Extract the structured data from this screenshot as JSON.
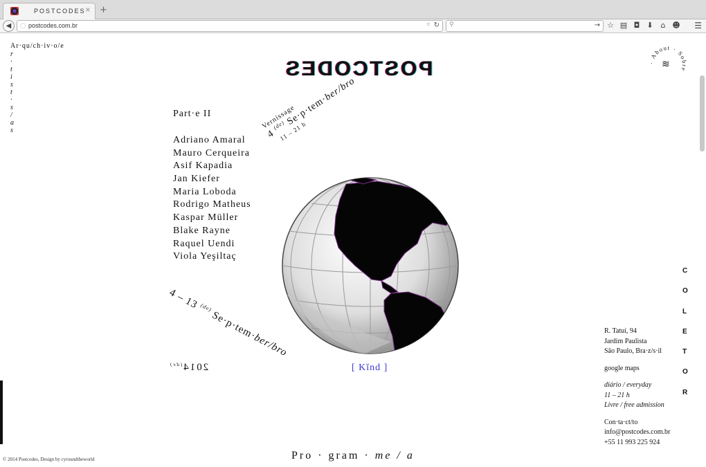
{
  "browser": {
    "tab_title": "POSTCODES",
    "tab_close": "×",
    "new_tab": "+",
    "url": "postcodes.com.br",
    "icons": [
      "back-icon",
      "globe-icon",
      "dropdown-icon",
      "reload-icon",
      "search-icon",
      "go-arrow-icon",
      "star-icon",
      "reading-list-icon",
      "pocket-icon",
      "download-icon",
      "home-icon",
      "chat-icon",
      "menu-icon"
    ]
  },
  "site": {
    "archive_horizontal": "Ar·qu/ch·iv·o/e",
    "archive_vertical": [
      "r",
      "·",
      "t",
      "i",
      "s",
      "t",
      "·",
      "s",
      "/",
      "a",
      "s"
    ],
    "logo": "POSTCODES",
    "about_circle": "· About · Sobre ",
    "part": "Part·e II",
    "artists": [
      "Adriano Amaral",
      "Mauro Cerqueira",
      "Asif Kapadia",
      "Jan Kiefer",
      "Maria Loboda",
      "Rodrigo Matheus",
      "Kaspar Müller",
      "Blake Rayne",
      "Raquel Uendi",
      "Viola Yeşiltaç"
    ],
    "vernissage": {
      "label": "Vernissage",
      "day": "4",
      "de": "(de)",
      "month": "Se·p·tem·",
      "month_it": "ber/bro",
      "hours": "11 – 21 h"
    },
    "daterange": {
      "days": "4 – 13",
      "de": "(de)",
      "month": "Se·p·tem·",
      "month_it": "ber/bro"
    },
    "year": "2014",
    "year_de": "(de)",
    "kind": "[ Kĭnd ]",
    "address": {
      "street": "R. Tatuí, 94",
      "district": "Jardim Paulista",
      "city": "São Paulo, Bra·z/s·il",
      "maps": "google maps",
      "days": "diário / everyday",
      "hours": "11 – 21 h",
      "admission": "Livre / free admission",
      "contact_label": "Con·ta·ct/to",
      "email": "info@postcodes.com.br",
      "phone": "+55 11 993 225 924"
    },
    "collector": [
      "C",
      "O",
      "L",
      "E",
      "T",
      "O",
      "R"
    ],
    "footer": "© 2014 Postcodes, Design by cyroundtheworld",
    "programme": "Pro · gram ·",
    "programme_it": "me / a"
  }
}
